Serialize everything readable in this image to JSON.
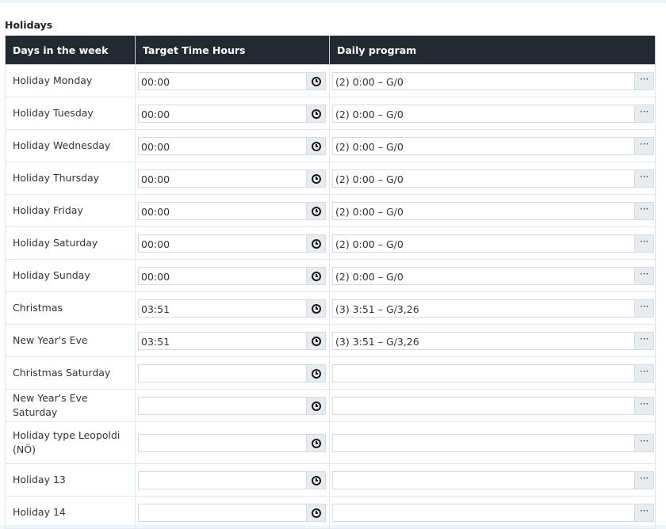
{
  "section": {
    "title": "Holidays"
  },
  "columns": [
    "Days in the week",
    "Target Time Hours",
    "Daily program"
  ],
  "icons": {
    "time_button": "clock-icon",
    "program_button": "ellipsis-icon",
    "ellipsis_glyph": "···"
  },
  "rows": [
    {
      "day": "Holiday Monday",
      "time": "00:00",
      "program": "(2) 0:00 – G/0"
    },
    {
      "day": "Holiday Tuesday",
      "time": "00:00",
      "program": "(2) 0:00 – G/0"
    },
    {
      "day": "Holiday Wednesday",
      "time": "00:00",
      "program": "(2) 0:00 – G/0"
    },
    {
      "day": "Holiday Thursday",
      "time": "00:00",
      "program": "(2) 0:00 – G/0"
    },
    {
      "day": "Holiday Friday",
      "time": "00:00",
      "program": "(2) 0:00 – G/0"
    },
    {
      "day": "Holiday Saturday",
      "time": "00:00",
      "program": "(2) 0:00 – G/0"
    },
    {
      "day": "Holiday Sunday",
      "time": "00:00",
      "program": "(2) 0:00 – G/0"
    },
    {
      "day": "Christmas",
      "time": "03:51",
      "program": "(3) 3:51 – G/3,26"
    },
    {
      "day": "New Year's Eve",
      "time": "03:51",
      "program": "(3) 3:51 – G/3,26"
    },
    {
      "day": "Christmas Saturday",
      "time": "",
      "program": ""
    },
    {
      "day": "New Year's Eve Saturday",
      "time": "",
      "program": ""
    },
    {
      "day": "Holiday type Leopoldi (NÖ)",
      "time": "",
      "program": ""
    },
    {
      "day": "Holiday 13",
      "time": "",
      "program": ""
    },
    {
      "day": "Holiday 14",
      "time": "",
      "program": ""
    }
  ]
}
